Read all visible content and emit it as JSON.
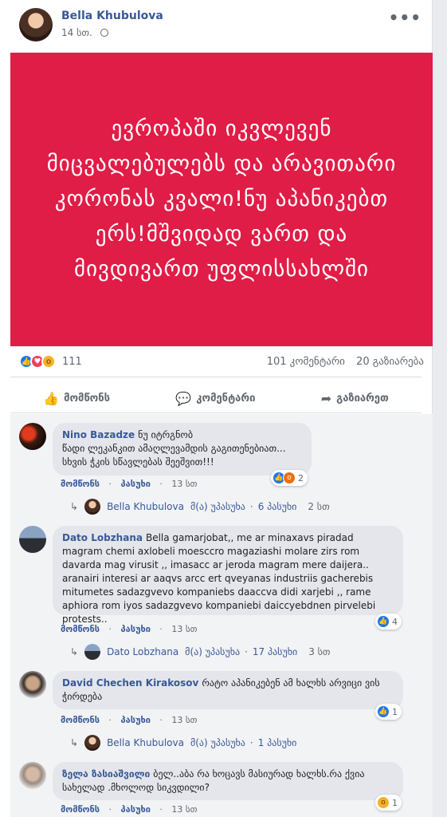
{
  "post": {
    "author": "Bella Khubulova",
    "time": "14 სთ.",
    "more": "•••",
    "banner_text": "ევროპაში იკვლევენ მიცვალებულებს და არავითარი კორონას კვალი!ნუ აპანიკებთ ერს!მშვიდად ვართ და მივდივართ უფლისსახლში",
    "colors": {
      "banner": "#e01d47",
      "link": "#385898"
    }
  },
  "stats": {
    "reaction_icons": [
      "like-icon",
      "love-icon",
      "wow-icon"
    ],
    "reaction_count": "111",
    "comments": "101 კომენტარი",
    "shares": "20 გაზიარება"
  },
  "actions": {
    "like": "მომწონს",
    "comment": "კომენტარი",
    "share": "გაზიარეთ"
  },
  "comments": [
    {
      "name": "Nino Bazadze",
      "text": "ნუ იტრგნობ\nწადი ლეკანკით ამაღლევამდის გაგითენებიათ... სხვის ჭკის სწავლებას შეეშვით!!!",
      "like": "მომწონს",
      "reply": "პასუხი",
      "time": "13 სთ",
      "reaction_count": "2",
      "reply_summary": {
        "name": "Bella Khubulova",
        "label": "მ(ა) უპასუხა",
        "sep": "·",
        "count": "6 პასუხი",
        "time": "2 სთ"
      }
    },
    {
      "name": "Dato Lobzhana",
      "text": "Bella gamarjobat,, me ar minaxavs piradad magram chemi axlobeli moesccro magaziashi molare zirs rom davarda mag virusit ,, imasacc ar jeroda magram mere daijera.. aranairi interesi ar aaqvs arcc ert qveyanas industriis gacherebis mitumetes sadazgvevo kompaniebs daaccva didi xarjebi ,, rame aphiora rom iyos sadazgvevo kompaniebi daiccyebdnen pirvelebi protests..",
      "like": "მომწონს",
      "reply": "პასუხი",
      "time": "13 სთ",
      "reaction_count": "4",
      "reply_summary": {
        "name": "Dato Lobzhana",
        "label": "მ(ა) უპასუხა",
        "sep": "·",
        "count": "17 პასუხი",
        "time": "3 სთ"
      }
    },
    {
      "name": "David Chechen Kirakosov",
      "text": "რატო აპანიკებენ ამ ხალხს არვიცი ვის ჭირდება",
      "like": "მომწონს",
      "reply": "პასუხი",
      "time": "13 სთ",
      "reaction_count": "1",
      "reply_summary": {
        "name": "Bella Khubulova",
        "label": "მ(ა) უპასუხა",
        "sep": "·",
        "count": "1 პასუხი",
        "time": ""
      }
    },
    {
      "name": "ზელა ზასიაშვილი",
      "text": "ბელ..აბა რა ხოცავს მასიურად ხალხს.რა ქვია სახელად .მხოლოდ სიკვდილი?",
      "like": "მომწონს",
      "reply": "პასუხი",
      "time": "13 სთ",
      "reaction_count": "1",
      "reply_summary": null
    }
  ]
}
